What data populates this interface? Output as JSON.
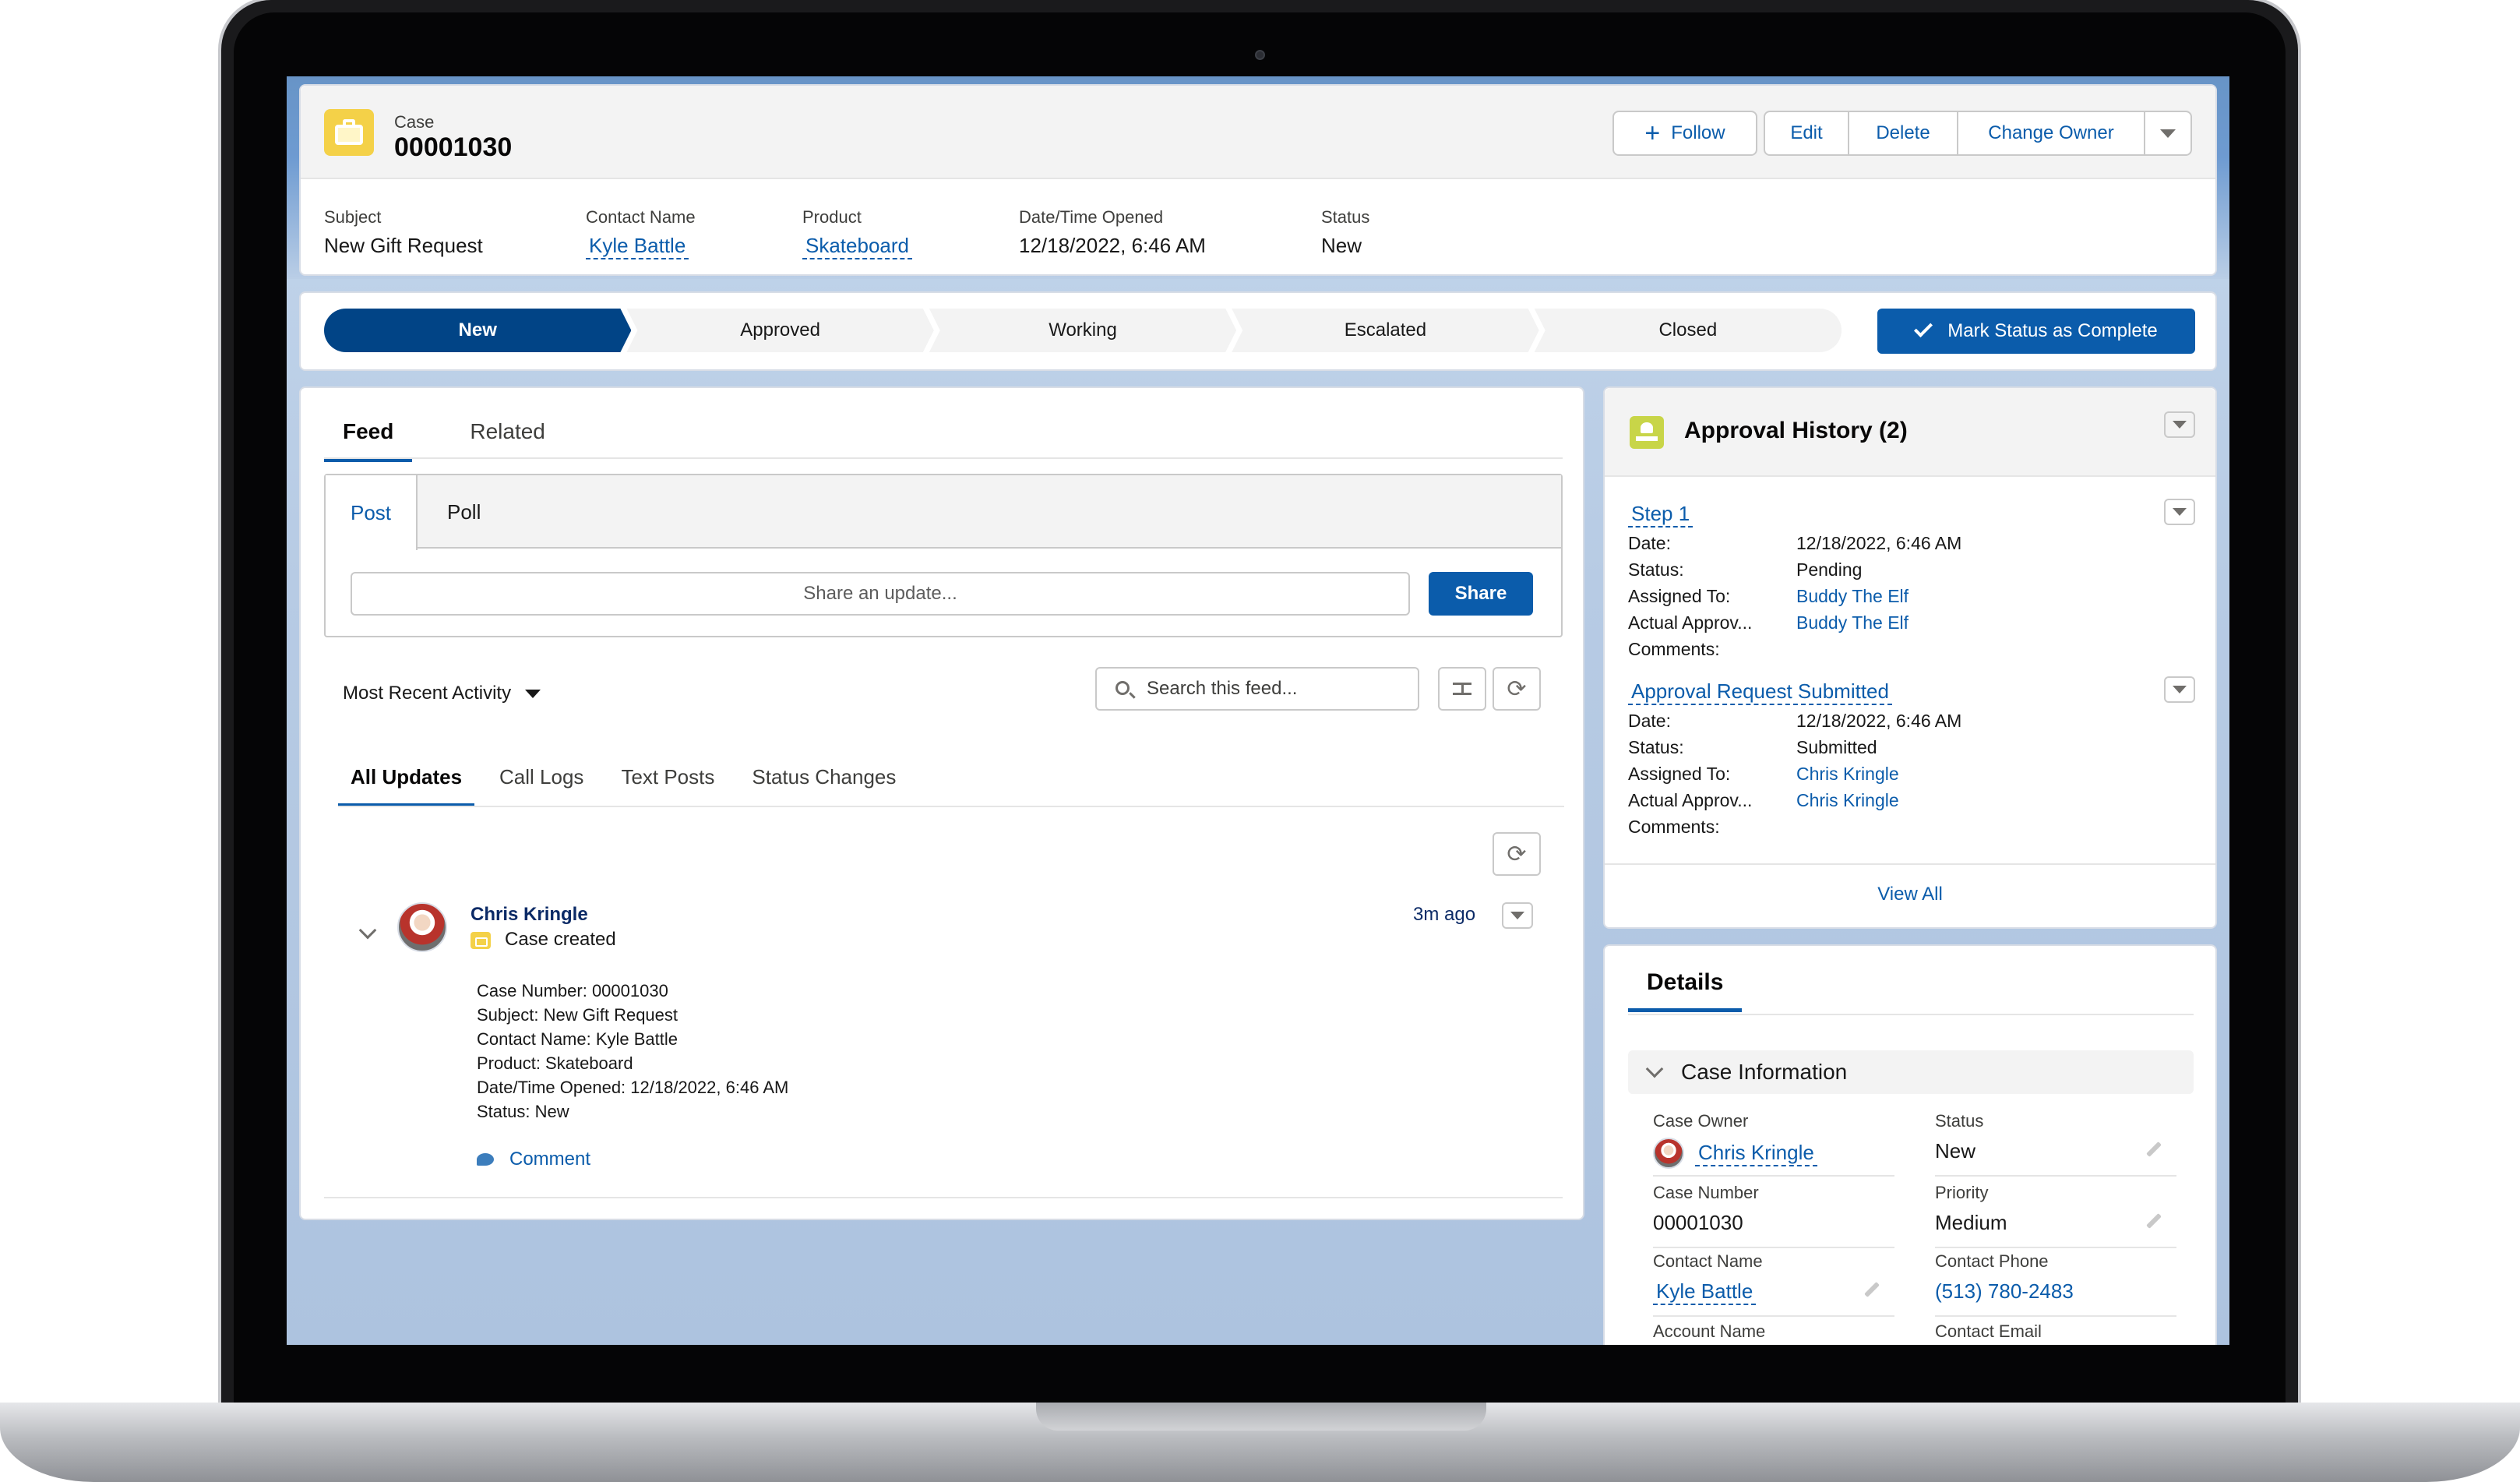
{
  "header": {
    "object_type": "Case",
    "record_name": "00001030",
    "buttons": {
      "follow": "Follow",
      "edit": "Edit",
      "delete": "Delete",
      "change_owner": "Change Owner"
    },
    "highlights": [
      {
        "label": "Subject",
        "value": "New Gift Request"
      },
      {
        "label": "Contact Name",
        "value": "Kyle Battle"
      },
      {
        "label": "Product",
        "value": "Skateboard"
      },
      {
        "label": "Date/Time Opened",
        "value": "12/18/2022, 6:46 AM"
      },
      {
        "label": "Status",
        "value": "New"
      }
    ]
  },
  "path": {
    "stages": [
      "New",
      "Approved",
      "Working",
      "Escalated",
      "Closed"
    ],
    "active_stage": "New",
    "complete_button": "Mark Status as Complete"
  },
  "feed": {
    "tabs": [
      "Feed",
      "Related"
    ],
    "publisher": {
      "tabs": [
        "Post",
        "Poll"
      ],
      "placeholder": "Share an update...",
      "share_button": "Share"
    },
    "sort_label": "Most Recent Activity",
    "search_placeholder": "Search this feed...",
    "filter_tabs": [
      "All Updates",
      "Call Logs",
      "Text Posts",
      "Status Changes"
    ],
    "item": {
      "author": "Chris Kringle",
      "action": "Case created",
      "time_ago": "3m ago",
      "lines": [
        "Case Number: 00001030",
        "Subject: New Gift Request",
        "Contact Name: Kyle Battle",
        "Product: Skateboard",
        "Date/Time Opened: 12/18/2022, 6:46 AM",
        "Status: New"
      ],
      "comment_label": "Comment"
    }
  },
  "approval_history": {
    "title": "Approval History (2)",
    "steps": [
      {
        "name": "Step 1",
        "rows": [
          {
            "key": "Date:",
            "value": "12/18/2022, 6:46 AM"
          },
          {
            "key": "Status:",
            "value": "Pending"
          },
          {
            "key": "Assigned To:",
            "value": "Buddy The Elf"
          },
          {
            "key": "Actual Approv...",
            "value": "Buddy The Elf"
          },
          {
            "key": "Comments:",
            "value": ""
          }
        ]
      },
      {
        "name": "Approval Request Submitted",
        "rows": [
          {
            "key": "Date:",
            "value": "12/18/2022, 6:46 AM"
          },
          {
            "key": "Status:",
            "value": "Submitted"
          },
          {
            "key": "Assigned To:",
            "value": "Chris Kringle"
          },
          {
            "key": "Actual Approv...",
            "value": "Chris Kringle"
          },
          {
            "key": "Comments:",
            "value": ""
          }
        ]
      }
    ],
    "view_all": "View All"
  },
  "details": {
    "tab": "Details",
    "section": "Case Information",
    "fields": {
      "case_owner": {
        "label": "Case Owner",
        "value": "Chris Kringle"
      },
      "status": {
        "label": "Status",
        "value": "New"
      },
      "case_number": {
        "label": "Case Number",
        "value": "00001030"
      },
      "priority": {
        "label": "Priority",
        "value": "Medium"
      },
      "contact_name": {
        "label": "Contact Name",
        "value": "Kyle Battle"
      },
      "contact_phone": {
        "label": "Contact Phone",
        "value": "(513) 780-2483"
      },
      "account_name": {
        "label": "Account Name",
        "value": ""
      },
      "contact_email": {
        "label": "Contact Email",
        "value": ""
      }
    }
  },
  "colors": {
    "brand_blue": "#0b5cab",
    "path_active": "#014486",
    "case_icon": "#f4d148",
    "approval_icon": "#c8d548"
  }
}
